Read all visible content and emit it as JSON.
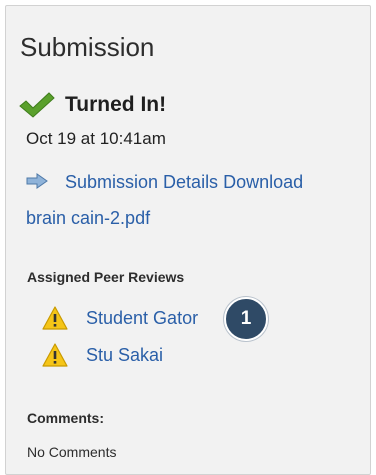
{
  "panel": {
    "title": "Submission",
    "status": {
      "icon": "check-icon",
      "label": "Turned In!",
      "color": "#5aa02c"
    },
    "submitted_at": "Oct 19 at 10:41am",
    "details": {
      "icon": "arrow-right-icon",
      "details_link": "Submission Details",
      "download_link_part1": "Download",
      "download_link_part2": "brain cain-2.pdf"
    },
    "peer_reviews": {
      "heading": "Assigned Peer Reviews",
      "items": [
        {
          "icon": "warning-icon",
          "name": "Student Gator"
        },
        {
          "icon": "warning-icon",
          "name": "Stu Sakai"
        }
      ],
      "callout_badge": "1",
      "badge_color": "#2f4a66"
    },
    "comments": {
      "heading": "Comments:",
      "text": "No Comments"
    },
    "link_color": "#2a5fa8"
  }
}
